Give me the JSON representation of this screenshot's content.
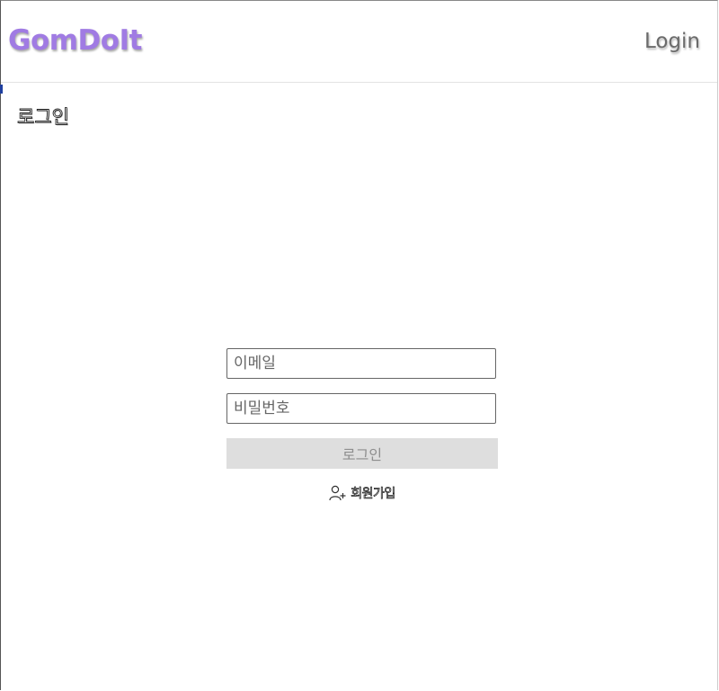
{
  "header": {
    "brand": "GomDoIt",
    "login_link": "Login"
  },
  "main": {
    "title": "로그인"
  },
  "login_form": {
    "email_placeholder": "이메일",
    "password_placeholder": "비밀번호",
    "submit_label": "로그인",
    "signup_label": "회원가입",
    "signup_icon": "user-plus-icon"
  },
  "colors": {
    "brand": "#a07be3",
    "button_bg": "#dedede",
    "button_text": "#8e8e8e"
  }
}
